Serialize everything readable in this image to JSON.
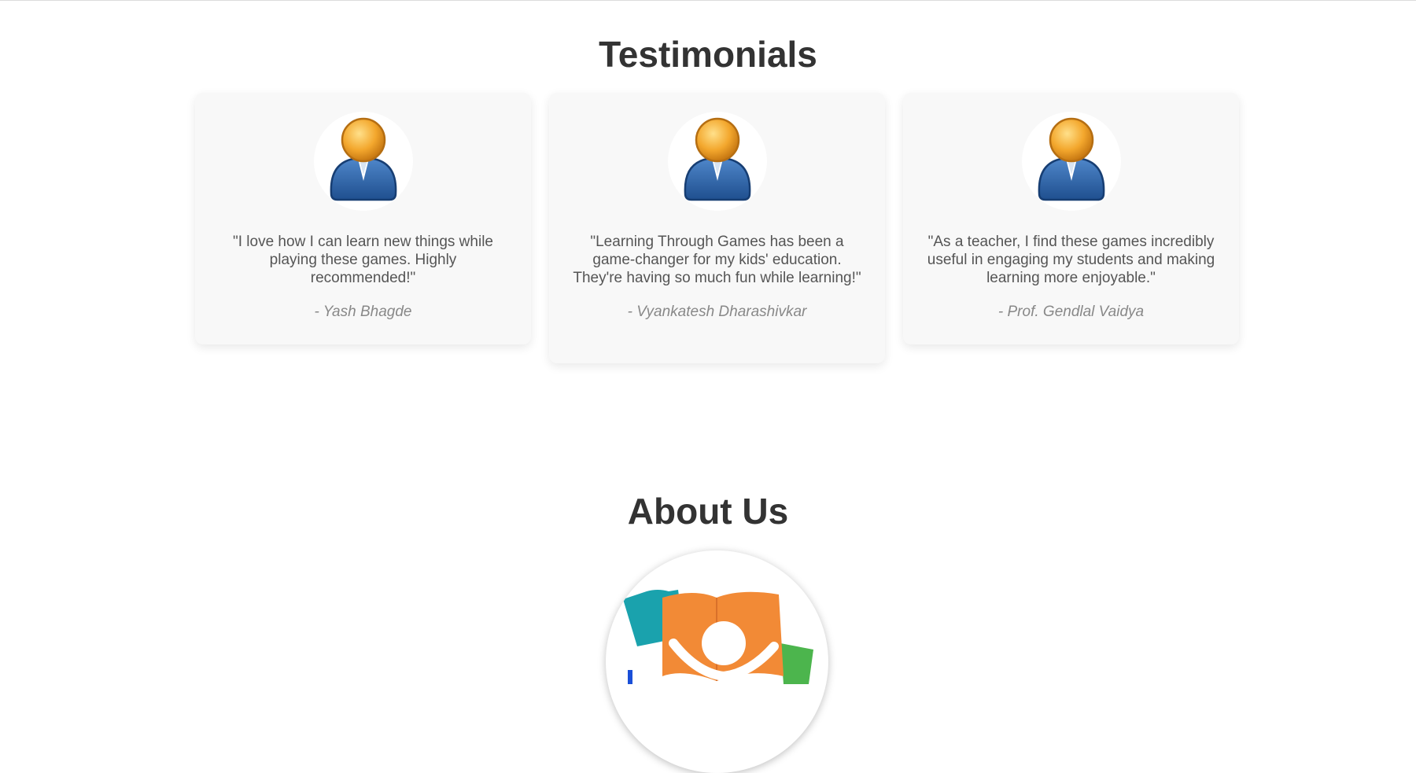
{
  "sections": {
    "testimonials_title": "Testimonials",
    "about_title": "About Us"
  },
  "testimonials": [
    {
      "quote": "\"I love how I can learn new things while playing these games. Highly recommended!\"",
      "author": "- Yash Bhagde"
    },
    {
      "quote": "\"Learning Through Games has been a game-changer for my kids' education. They're having so much fun while learning!\"",
      "author": "- Vyankatesh Dharashivkar"
    },
    {
      "quote": "\"As a teacher, I find these games incredibly useful in engaging my students and making learning more enjoyable.\"",
      "author": "- Prof. Gendlal Vaidya"
    }
  ],
  "icons": {
    "avatar": "user-avatar-icon",
    "logo": "open-book-child-logo"
  },
  "colors": {
    "heading": "#333333",
    "quote_text": "#555555",
    "author_text": "#888888",
    "card_bg": "#f8f8f8",
    "logo_orange": "#f28a36",
    "logo_teal": "#1aa2ad",
    "logo_green": "#4cb54d"
  }
}
